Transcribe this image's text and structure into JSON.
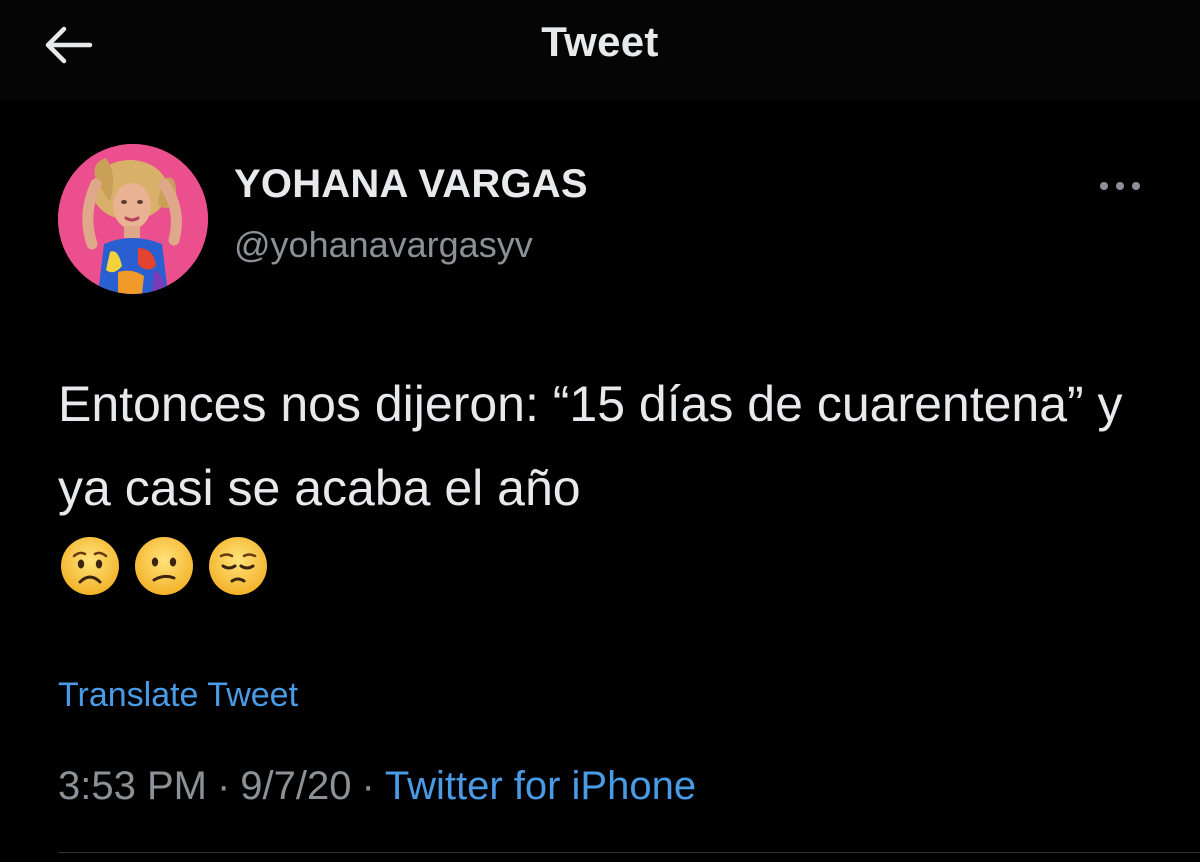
{
  "header": {
    "title": "Tweet",
    "back_icon": "back-arrow-icon"
  },
  "author": {
    "display_name": "YOHANA VARGAS",
    "handle": "@yohanavargasyv",
    "avatar_bg": "#ec4f8e"
  },
  "tweet": {
    "text": "Entonces nos dijeron: “15 días de cuarentena” y ya casi se acaba el año",
    "emojis": [
      "worried-face-emoji",
      "confused-face-emoji",
      "pensive-face-emoji"
    ],
    "translate_label": "Translate Tweet",
    "time": "3:53 PM",
    "date": "9/7/20",
    "source": "Twitter for iPhone",
    "separator": "·"
  },
  "colors": {
    "background": "#000000",
    "text": "#e7e9ea",
    "secondary": "#8b9196",
    "link": "#4a9be6"
  }
}
